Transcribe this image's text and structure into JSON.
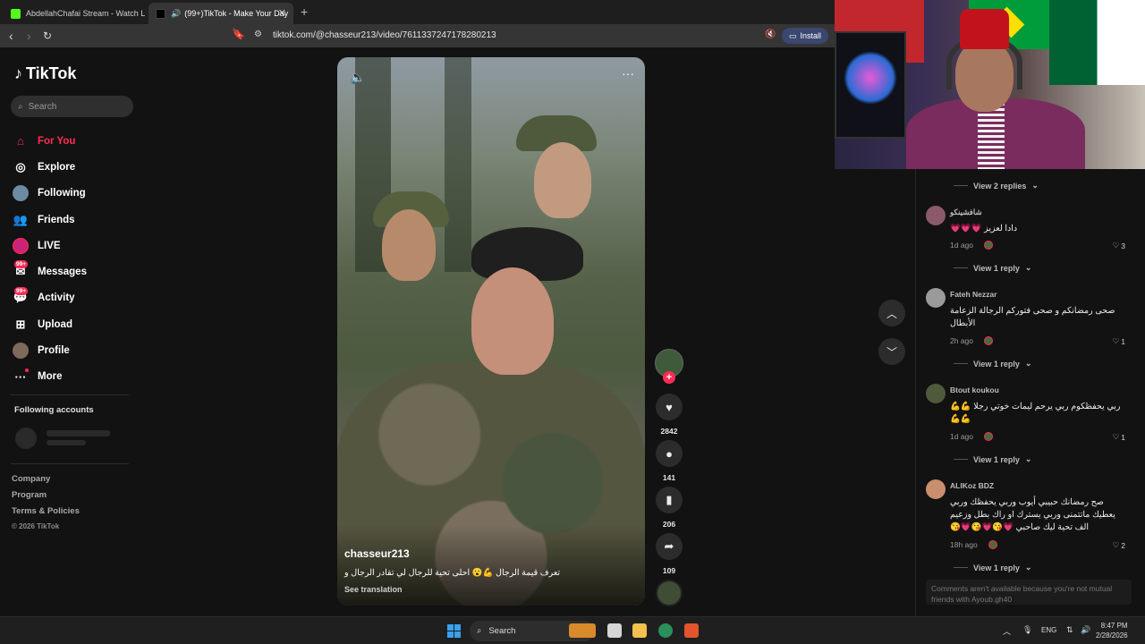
{
  "browser": {
    "tabs": [
      {
        "title": "AbdellahChafai Stream - Watch Live..."
      },
      {
        "title": "(99+)TikTok - Make Your Day"
      }
    ],
    "url": "tiktok.com/@chasseur213/video/7611337247178280213",
    "install_label": "Install"
  },
  "sidebar": {
    "logo": "TikTok",
    "search_placeholder": "Search",
    "nav": [
      {
        "label": "For You",
        "icon": "home-icon",
        "active": true
      },
      {
        "label": "Explore",
        "icon": "compass-icon"
      },
      {
        "label": "Following",
        "icon": "following-avatar-icon"
      },
      {
        "label": "Friends",
        "icon": "friends-icon"
      },
      {
        "label": "LIVE",
        "icon": "live-avatar-icon"
      },
      {
        "label": "Messages",
        "icon": "messages-icon",
        "badge": "99+"
      },
      {
        "label": "Activity",
        "icon": "activity-icon",
        "badge": "99+"
      },
      {
        "label": "Upload",
        "icon": "upload-icon"
      },
      {
        "label": "Profile",
        "icon": "profile-avatar-icon"
      },
      {
        "label": "More",
        "icon": "more-icon"
      }
    ],
    "following_accounts_title": "Following accounts",
    "footer": {
      "company": "Company",
      "program": "Program",
      "terms": "Terms & Policies",
      "copyright": "© 2026 TikTok"
    }
  },
  "video": {
    "author": "chasseur213",
    "caption": "تعرف قيمة الرجال 💪😮 احلى تحية للرجال لي تقادر الرجال و",
    "see_translation": "See translation"
  },
  "actions": {
    "likes": "2842",
    "comments": "141",
    "saves": "206",
    "shares": "109"
  },
  "comments": {
    "top_view_replies": "View 2 replies",
    "items": [
      {
        "user": "شافشينكو",
        "text": "دادا لعزيز 💗💗💗",
        "time": "1d ago",
        "likes": "3",
        "view_replies": "View 1 reply"
      },
      {
        "user": "Fateh Nezzar",
        "text": "صحى رمضانكم و صحى فتوركم الرجالة الزعامة الأبطال",
        "time": "2h ago",
        "likes": "1",
        "view_replies": "View 1 reply"
      },
      {
        "user": "Btout koukou",
        "text": "ربي يحفظكوم ربي يرحم ليمات خوتي رجلا 💪💪💪💪",
        "time": "1d ago",
        "likes": "1",
        "view_replies": "View 1 reply"
      },
      {
        "user": "ALIKoz BDZ",
        "text": "صح رمضانك حبيبي أيوب وربي يحفظك وربي يعطيك ماتتمنى وربي يسترك او راك بطل وزعيم الف تحية ليك صاحبي 💗😘💗😘💗😘",
        "time": "18h ago",
        "likes": "2",
        "view_replies": "View 1 reply"
      }
    ],
    "unavailable_note": "Comments aren't available because you're not mutual friends with Ayoub.gh40"
  },
  "taskbar": {
    "search_label": "Search",
    "lang": "ENG",
    "time": "8:47 PM",
    "date": "2/28/2026"
  }
}
